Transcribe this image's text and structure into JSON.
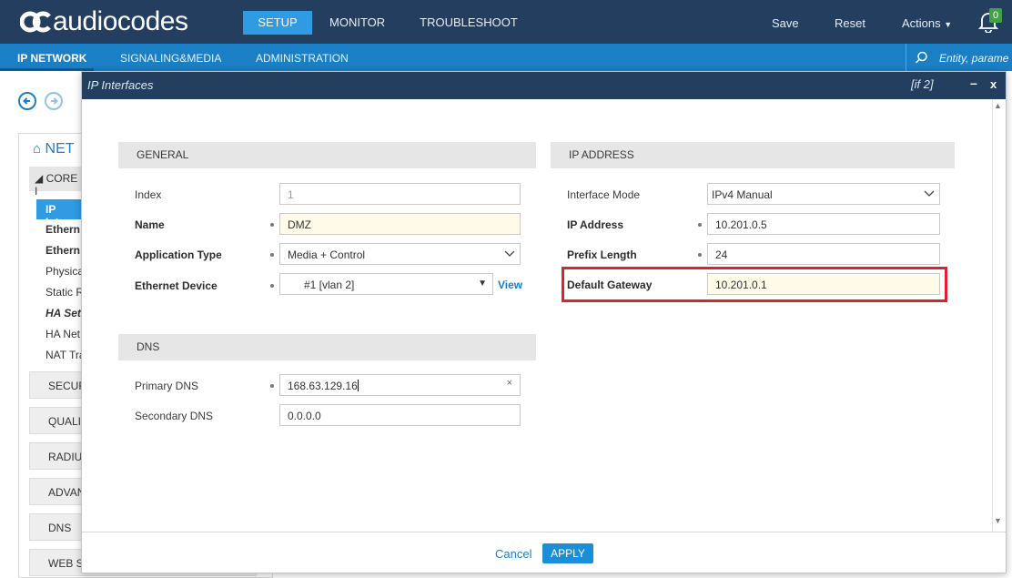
{
  "brand": {
    "name": "audiocodes"
  },
  "topnav": {
    "tabs": [
      "SETUP",
      "MONITOR",
      "TROUBLESHOOT"
    ],
    "active": "SETUP"
  },
  "topright": {
    "save": "Save",
    "reset": "Reset",
    "actions": "Actions",
    "notifications": "0"
  },
  "secnav": {
    "tabs": [
      "IP NETWORK",
      "SIGNALING&MEDIA",
      "ADMINISTRATION"
    ],
    "active": "IP NETWORK"
  },
  "search": {
    "placeholder": "Entity, parame"
  },
  "leftpanel": {
    "title": "NET",
    "core": "CORE I",
    "selected": "IP Inter",
    "items": [
      "Ethern",
      "Ethern",
      "Physica",
      "Static R",
      "HA Set",
      "HA Net",
      "NAT Tra"
    ],
    "groups": [
      "SECUR",
      "QUALI",
      "RADIU",
      "ADVAN",
      "DNS",
      "WEB S"
    ]
  },
  "modal": {
    "title": "IP Interfaces",
    "index_tag": "[if 2]",
    "minimize": "–",
    "close": "x",
    "general": {
      "header": "GENERAL",
      "index_label": "Index",
      "index_value": "1",
      "name_label": "Name",
      "name_value": "DMZ",
      "apptype_label": "Application Type",
      "apptype_value": "Media + Control",
      "ethdev_label": "Ethernet Device",
      "ethdev_value": "#1 [vlan 2]",
      "view_link": "View"
    },
    "dns": {
      "header": "DNS",
      "primary_label": "Primary DNS",
      "primary_value": "168.63.129.16",
      "secondary_label": "Secondary DNS",
      "secondary_value": "0.0.0.0"
    },
    "ipaddr": {
      "header": "IP ADDRESS",
      "mode_label": "Interface Mode",
      "mode_value": "IPv4 Manual",
      "ip_label": "IP Address",
      "ip_value": "10.201.0.5",
      "prefix_label": "Prefix Length",
      "prefix_value": "24",
      "gw_label": "Default Gateway",
      "gw_value": "10.201.0.1"
    },
    "footer": {
      "cancel": "Cancel",
      "apply": "APPLY"
    }
  },
  "colors": {
    "header": "#233e5f",
    "accent": "#1a7fc4",
    "highlight": "#e0202e"
  }
}
